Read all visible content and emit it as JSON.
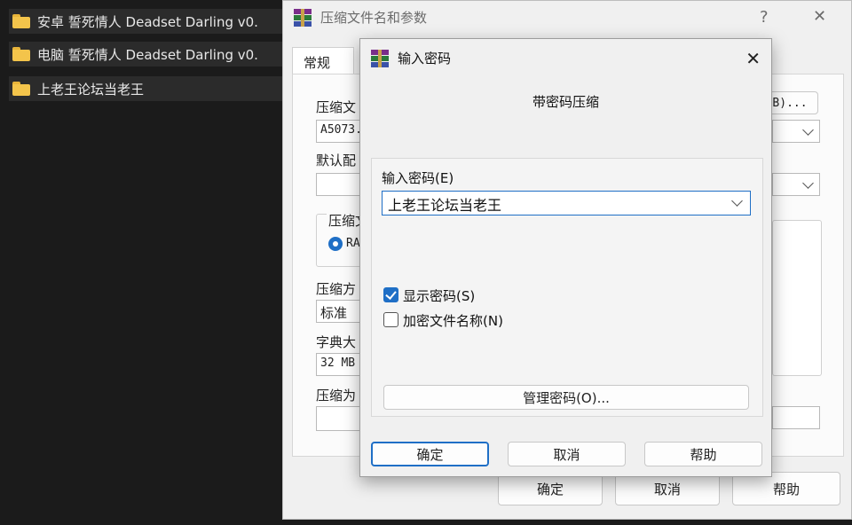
{
  "explorer": {
    "folders": [
      {
        "name": "安卓 誓死情人 Deadset Darling v0."
      },
      {
        "name": "电脑 誓死情人 Deadset Darling v0."
      },
      {
        "name": "上老王论坛当老王"
      }
    ]
  },
  "main_dialog": {
    "title": "压缩文件名和参数",
    "help_glyph": "?",
    "close_glyph": "✕",
    "tab_general": "常规",
    "archive_name_label": "压缩文",
    "archive_name_value": "A5073.",
    "browse_suffix": "B)...",
    "default_profile_label": "默认配",
    "format_group_label": "压缩文",
    "format_rar_label": "RA",
    "method_label": "压缩方",
    "method_value": "标准",
    "dict_label": "字典大",
    "dict_value": "32 MB",
    "split_label": "压缩为",
    "ok": "确定",
    "cancel": "取消",
    "help": "帮助"
  },
  "password_dialog": {
    "title": "输入密码",
    "close_glyph": "✕",
    "heading": "带密码压缩",
    "password_label": "输入密码(E)",
    "password_value": "上老王论坛当老王",
    "show_password_label": "显示密码(S)",
    "show_password_checked": true,
    "encrypt_names_label": "加密文件名称(N)",
    "encrypt_names_checked": false,
    "manage_button": "管理密码(O)...",
    "ok": "确定",
    "cancel": "取消",
    "help": "帮助"
  },
  "colors": {
    "accent": "#1f6fc6",
    "folder": "#f3c44b",
    "explorer_bg": "#1b1b1b"
  }
}
